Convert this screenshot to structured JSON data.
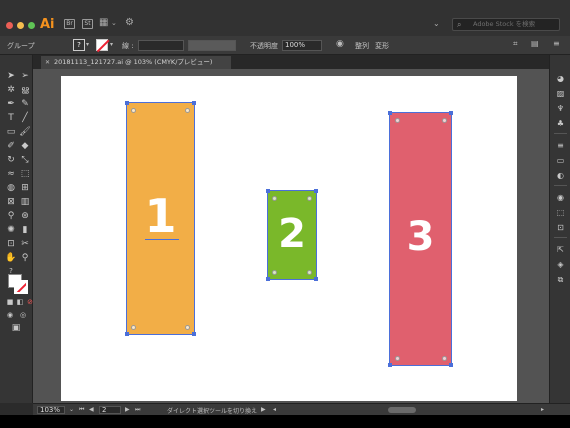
{
  "app": {
    "logo": "Ai"
  },
  "search": {
    "placeholder": "Adobe Stock を検索"
  },
  "control_bar": {
    "selection_label": "グループ",
    "stroke_label": "線 :",
    "opacity_label": "不透明度",
    "opacity_value": "100%",
    "align_label": "整列",
    "transform_label": "変形"
  },
  "document_tab": {
    "title": "20181113_121727.ai @ 103% (CMYK/プレビュー)"
  },
  "artwork": [
    {
      "number": "1",
      "color": "#f2ae47"
    },
    {
      "number": "2",
      "color": "#7ab82a"
    },
    {
      "number": "3",
      "color": "#e0606e"
    }
  ],
  "status_bar": {
    "zoom": "103%",
    "page": "2",
    "message": "ダイレクト選択ツールを切り換え"
  },
  "colors": {
    "selection": "#4b6fd9",
    "accent": "#f5921e"
  }
}
